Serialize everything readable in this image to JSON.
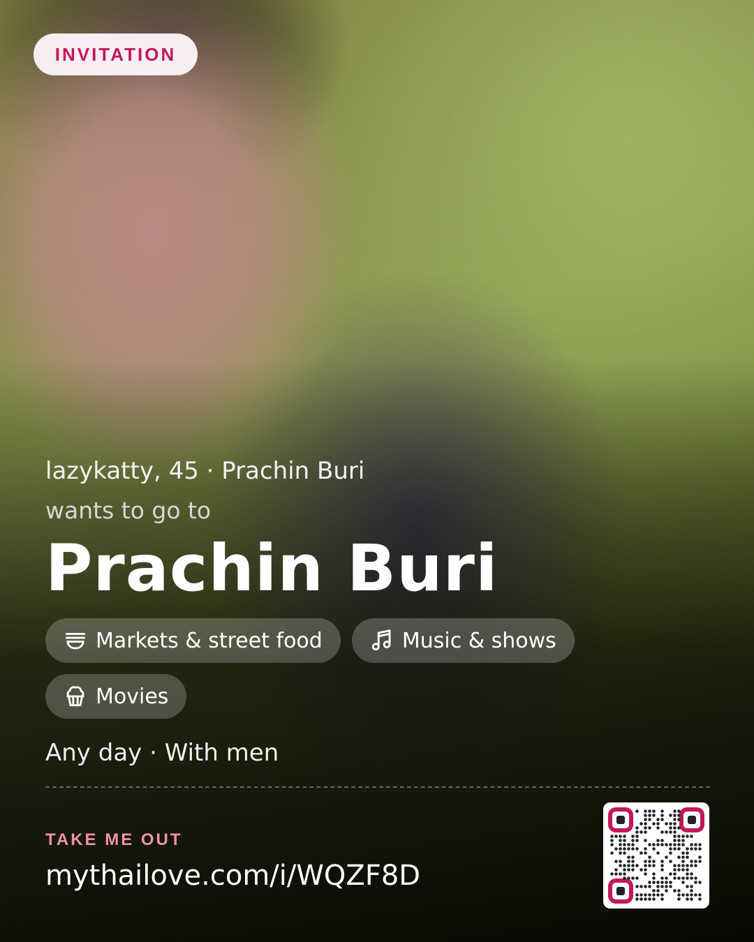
{
  "badge": "INVITATION",
  "profile": {
    "line": "lazykatty, 45 · Prachin Buri",
    "wants": "wants to go to",
    "destination": "Prachin Buri"
  },
  "interests": [
    {
      "label": "Markets & street food",
      "icon": "bowl-icon"
    },
    {
      "label": "Music & shows",
      "icon": "music-note-icon"
    },
    {
      "label": "Movies",
      "icon": "popcorn-icon"
    }
  ],
  "details": "Any day · With men",
  "cta": {
    "label": "TAKE ME OUT",
    "url": "mythailove.com/i/WQZF8D"
  },
  "colors": {
    "accent": "#c2185b",
    "accent_light": "#f48fb1"
  }
}
